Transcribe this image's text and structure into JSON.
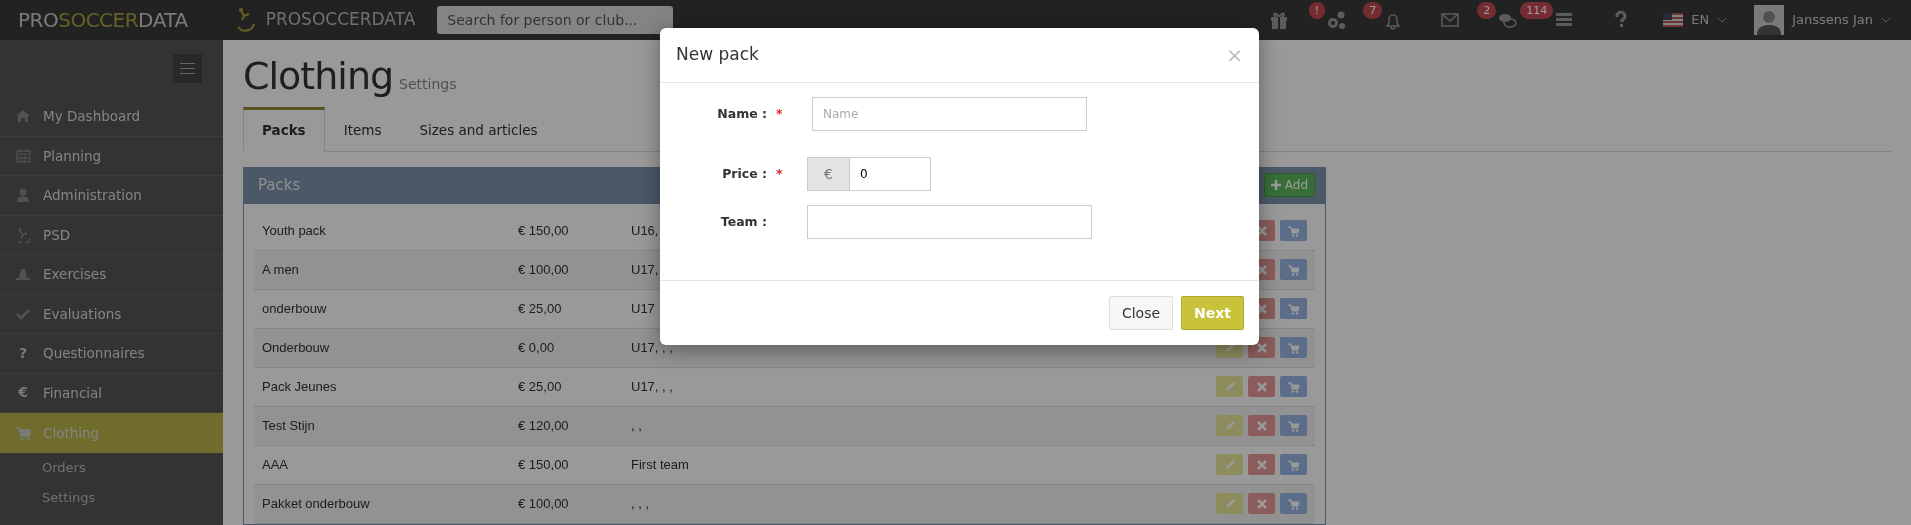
{
  "topbar": {
    "logo_parts": [
      "PRO",
      "SOCCER",
      "DATA"
    ],
    "brand": "PROSOCCERDATA",
    "search": {
      "placeholder": "Search for person or club..."
    },
    "icons": [
      {
        "kind": "gift"
      },
      {
        "kind": "gears",
        "badge": "!"
      },
      {
        "kind": "bell",
        "badge": "7"
      },
      {
        "kind": "envelope"
      },
      {
        "kind": "chat",
        "badge": "2"
      },
      {
        "kind": "list",
        "badge": "114"
      },
      {
        "kind": "question"
      }
    ],
    "language": "EN",
    "user": "Janssens Jan"
  },
  "sidebar": {
    "items": [
      {
        "label": "My Dashboard",
        "kind": "home",
        "selected": false
      },
      {
        "label": "Planning",
        "kind": "calendar",
        "selected": false
      },
      {
        "label": "Administration",
        "kind": "user",
        "selected": false
      },
      {
        "label": "PSD",
        "kind": "kick",
        "selected": false
      },
      {
        "label": "Exercises",
        "kind": "cone",
        "selected": false
      },
      {
        "label": "Evaluations",
        "kind": "check",
        "selected": false
      },
      {
        "label": "Questionnaires",
        "glyph": "?",
        "selected": false
      },
      {
        "label": "Financial",
        "glyph": "€",
        "selected": false
      },
      {
        "label": "Clothing",
        "kind": "cart",
        "selected": true,
        "children": [
          {
            "label": "Orders"
          },
          {
            "label": "Settings"
          }
        ]
      }
    ]
  },
  "page": {
    "title": "Clothing",
    "subtitle": "Settings",
    "tabs": [
      {
        "label": "Packs",
        "selected": true
      },
      {
        "label": "Items",
        "selected": false
      },
      {
        "label": "Sizes and articles",
        "selected": false
      }
    ],
    "panel": {
      "title": "Packs",
      "add_button": "Add",
      "rows": [
        {
          "name": "Youth pack",
          "price": "€ 150,00",
          "team": "U16,",
          "actions": [
            {
              "kind": "delete"
            },
            {
              "kind": "cart"
            }
          ]
        },
        {
          "name": "A men",
          "price": "€ 100,00",
          "team": "U17,",
          "actions": [
            {
              "kind": "delete"
            },
            {
              "kind": "cart"
            }
          ]
        },
        {
          "name": "onderbouw",
          "price": "€ 25,00",
          "team": "U17",
          "actions": [
            {
              "kind": "delete"
            },
            {
              "kind": "cart"
            }
          ]
        },
        {
          "name": "Onderbouw",
          "price": "€ 0,00",
          "team": "U17, , ,",
          "actions": [
            {
              "kind": "edit"
            },
            {
              "kind": "delete"
            },
            {
              "kind": "cart"
            }
          ]
        },
        {
          "name": "Pack Jeunes",
          "price": "€ 25,00",
          "team": "U17, , ,",
          "actions": [
            {
              "kind": "edit"
            },
            {
              "kind": "delete"
            },
            {
              "kind": "cart"
            }
          ]
        },
        {
          "name": "Test Stijn",
          "price": "€ 120,00",
          "team": ", ,",
          "actions": [
            {
              "kind": "edit"
            },
            {
              "kind": "delete"
            },
            {
              "kind": "cart"
            }
          ]
        },
        {
          "name": "AAA",
          "price": "€ 150,00",
          "team": "First team",
          "actions": [
            {
              "kind": "edit"
            },
            {
              "kind": "delete"
            },
            {
              "kind": "cart"
            }
          ]
        },
        {
          "name": "Pakket onderbouw",
          "price": "€ 100,00",
          "team": ", , ,",
          "actions": [
            {
              "kind": "edit"
            },
            {
              "kind": "delete"
            },
            {
              "kind": "cart"
            }
          ]
        }
      ]
    }
  },
  "modal": {
    "title": "New pack",
    "close_glyph": "×",
    "fields": [
      {
        "kind": "text",
        "label": "Name :",
        "required_mark": "*",
        "placeholder": "Name"
      },
      {
        "kind": "money",
        "label": "Price :",
        "required_mark": "*",
        "addon": "€",
        "value": "0"
      },
      {
        "kind": "text",
        "label": "Team :"
      }
    ],
    "buttons": [
      {
        "label": "Close",
        "kind": "secondary"
      },
      {
        "label": "Next",
        "kind": "primary"
      }
    ]
  }
}
